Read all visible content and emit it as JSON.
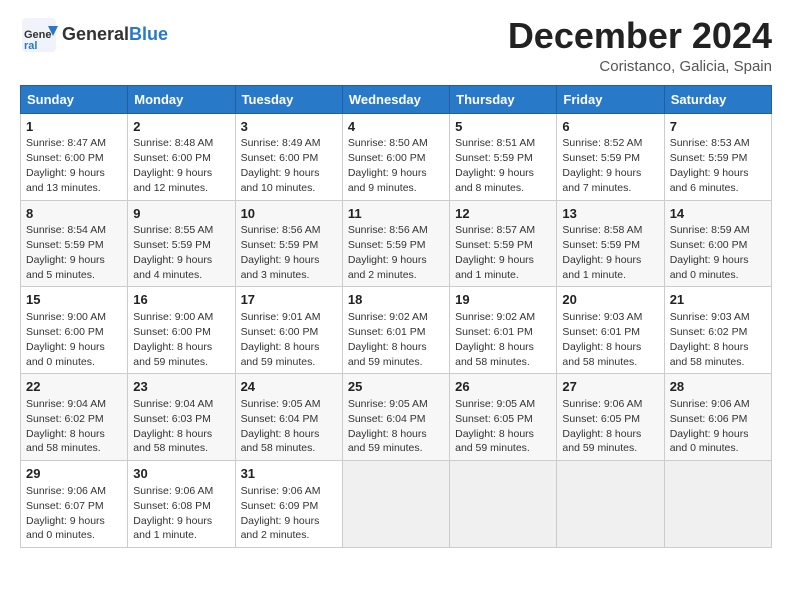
{
  "header": {
    "logo_general": "General",
    "logo_blue": "Blue",
    "month_title": "December 2024",
    "location": "Coristanco, Galicia, Spain"
  },
  "weekdays": [
    "Sunday",
    "Monday",
    "Tuesday",
    "Wednesday",
    "Thursday",
    "Friday",
    "Saturday"
  ],
  "weeks": [
    [
      {
        "day": "1",
        "sunrise": "8:47 AM",
        "sunset": "6:00 PM",
        "daylight": "9 hours and 13 minutes."
      },
      {
        "day": "2",
        "sunrise": "8:48 AM",
        "sunset": "6:00 PM",
        "daylight": "9 hours and 12 minutes."
      },
      {
        "day": "3",
        "sunrise": "8:49 AM",
        "sunset": "6:00 PM",
        "daylight": "9 hours and 10 minutes."
      },
      {
        "day": "4",
        "sunrise": "8:50 AM",
        "sunset": "6:00 PM",
        "daylight": "9 hours and 9 minutes."
      },
      {
        "day": "5",
        "sunrise": "8:51 AM",
        "sunset": "5:59 PM",
        "daylight": "9 hours and 8 minutes."
      },
      {
        "day": "6",
        "sunrise": "8:52 AM",
        "sunset": "5:59 PM",
        "daylight": "9 hours and 7 minutes."
      },
      {
        "day": "7",
        "sunrise": "8:53 AM",
        "sunset": "5:59 PM",
        "daylight": "9 hours and 6 minutes."
      }
    ],
    [
      {
        "day": "8",
        "sunrise": "8:54 AM",
        "sunset": "5:59 PM",
        "daylight": "9 hours and 5 minutes."
      },
      {
        "day": "9",
        "sunrise": "8:55 AM",
        "sunset": "5:59 PM",
        "daylight": "9 hours and 4 minutes."
      },
      {
        "day": "10",
        "sunrise": "8:56 AM",
        "sunset": "5:59 PM",
        "daylight": "9 hours and 3 minutes."
      },
      {
        "day": "11",
        "sunrise": "8:56 AM",
        "sunset": "5:59 PM",
        "daylight": "9 hours and 2 minutes."
      },
      {
        "day": "12",
        "sunrise": "8:57 AM",
        "sunset": "5:59 PM",
        "daylight": "9 hours and 1 minute."
      },
      {
        "day": "13",
        "sunrise": "8:58 AM",
        "sunset": "5:59 PM",
        "daylight": "9 hours and 1 minute."
      },
      {
        "day": "14",
        "sunrise": "8:59 AM",
        "sunset": "6:00 PM",
        "daylight": "9 hours and 0 minutes."
      }
    ],
    [
      {
        "day": "15",
        "sunrise": "9:00 AM",
        "sunset": "6:00 PM",
        "daylight": "9 hours and 0 minutes."
      },
      {
        "day": "16",
        "sunrise": "9:00 AM",
        "sunset": "6:00 PM",
        "daylight": "8 hours and 59 minutes."
      },
      {
        "day": "17",
        "sunrise": "9:01 AM",
        "sunset": "6:00 PM",
        "daylight": "8 hours and 59 minutes."
      },
      {
        "day": "18",
        "sunrise": "9:02 AM",
        "sunset": "6:01 PM",
        "daylight": "8 hours and 59 minutes."
      },
      {
        "day": "19",
        "sunrise": "9:02 AM",
        "sunset": "6:01 PM",
        "daylight": "8 hours and 58 minutes."
      },
      {
        "day": "20",
        "sunrise": "9:03 AM",
        "sunset": "6:01 PM",
        "daylight": "8 hours and 58 minutes."
      },
      {
        "day": "21",
        "sunrise": "9:03 AM",
        "sunset": "6:02 PM",
        "daylight": "8 hours and 58 minutes."
      }
    ],
    [
      {
        "day": "22",
        "sunrise": "9:04 AM",
        "sunset": "6:02 PM",
        "daylight": "8 hours and 58 minutes."
      },
      {
        "day": "23",
        "sunrise": "9:04 AM",
        "sunset": "6:03 PM",
        "daylight": "8 hours and 58 minutes."
      },
      {
        "day": "24",
        "sunrise": "9:05 AM",
        "sunset": "6:04 PM",
        "daylight": "8 hours and 58 minutes."
      },
      {
        "day": "25",
        "sunrise": "9:05 AM",
        "sunset": "6:04 PM",
        "daylight": "8 hours and 59 minutes."
      },
      {
        "day": "26",
        "sunrise": "9:05 AM",
        "sunset": "6:05 PM",
        "daylight": "8 hours and 59 minutes."
      },
      {
        "day": "27",
        "sunrise": "9:06 AM",
        "sunset": "6:05 PM",
        "daylight": "8 hours and 59 minutes."
      },
      {
        "day": "28",
        "sunrise": "9:06 AM",
        "sunset": "6:06 PM",
        "daylight": "9 hours and 0 minutes."
      }
    ],
    [
      {
        "day": "29",
        "sunrise": "9:06 AM",
        "sunset": "6:07 PM",
        "daylight": "9 hours and 0 minutes."
      },
      {
        "day": "30",
        "sunrise": "9:06 AM",
        "sunset": "6:08 PM",
        "daylight": "9 hours and 1 minute."
      },
      {
        "day": "31",
        "sunrise": "9:06 AM",
        "sunset": "6:09 PM",
        "daylight": "9 hours and 2 minutes."
      },
      null,
      null,
      null,
      null
    ]
  ],
  "labels": {
    "sunrise": "Sunrise:",
    "sunset": "Sunset:",
    "daylight": "Daylight:"
  }
}
